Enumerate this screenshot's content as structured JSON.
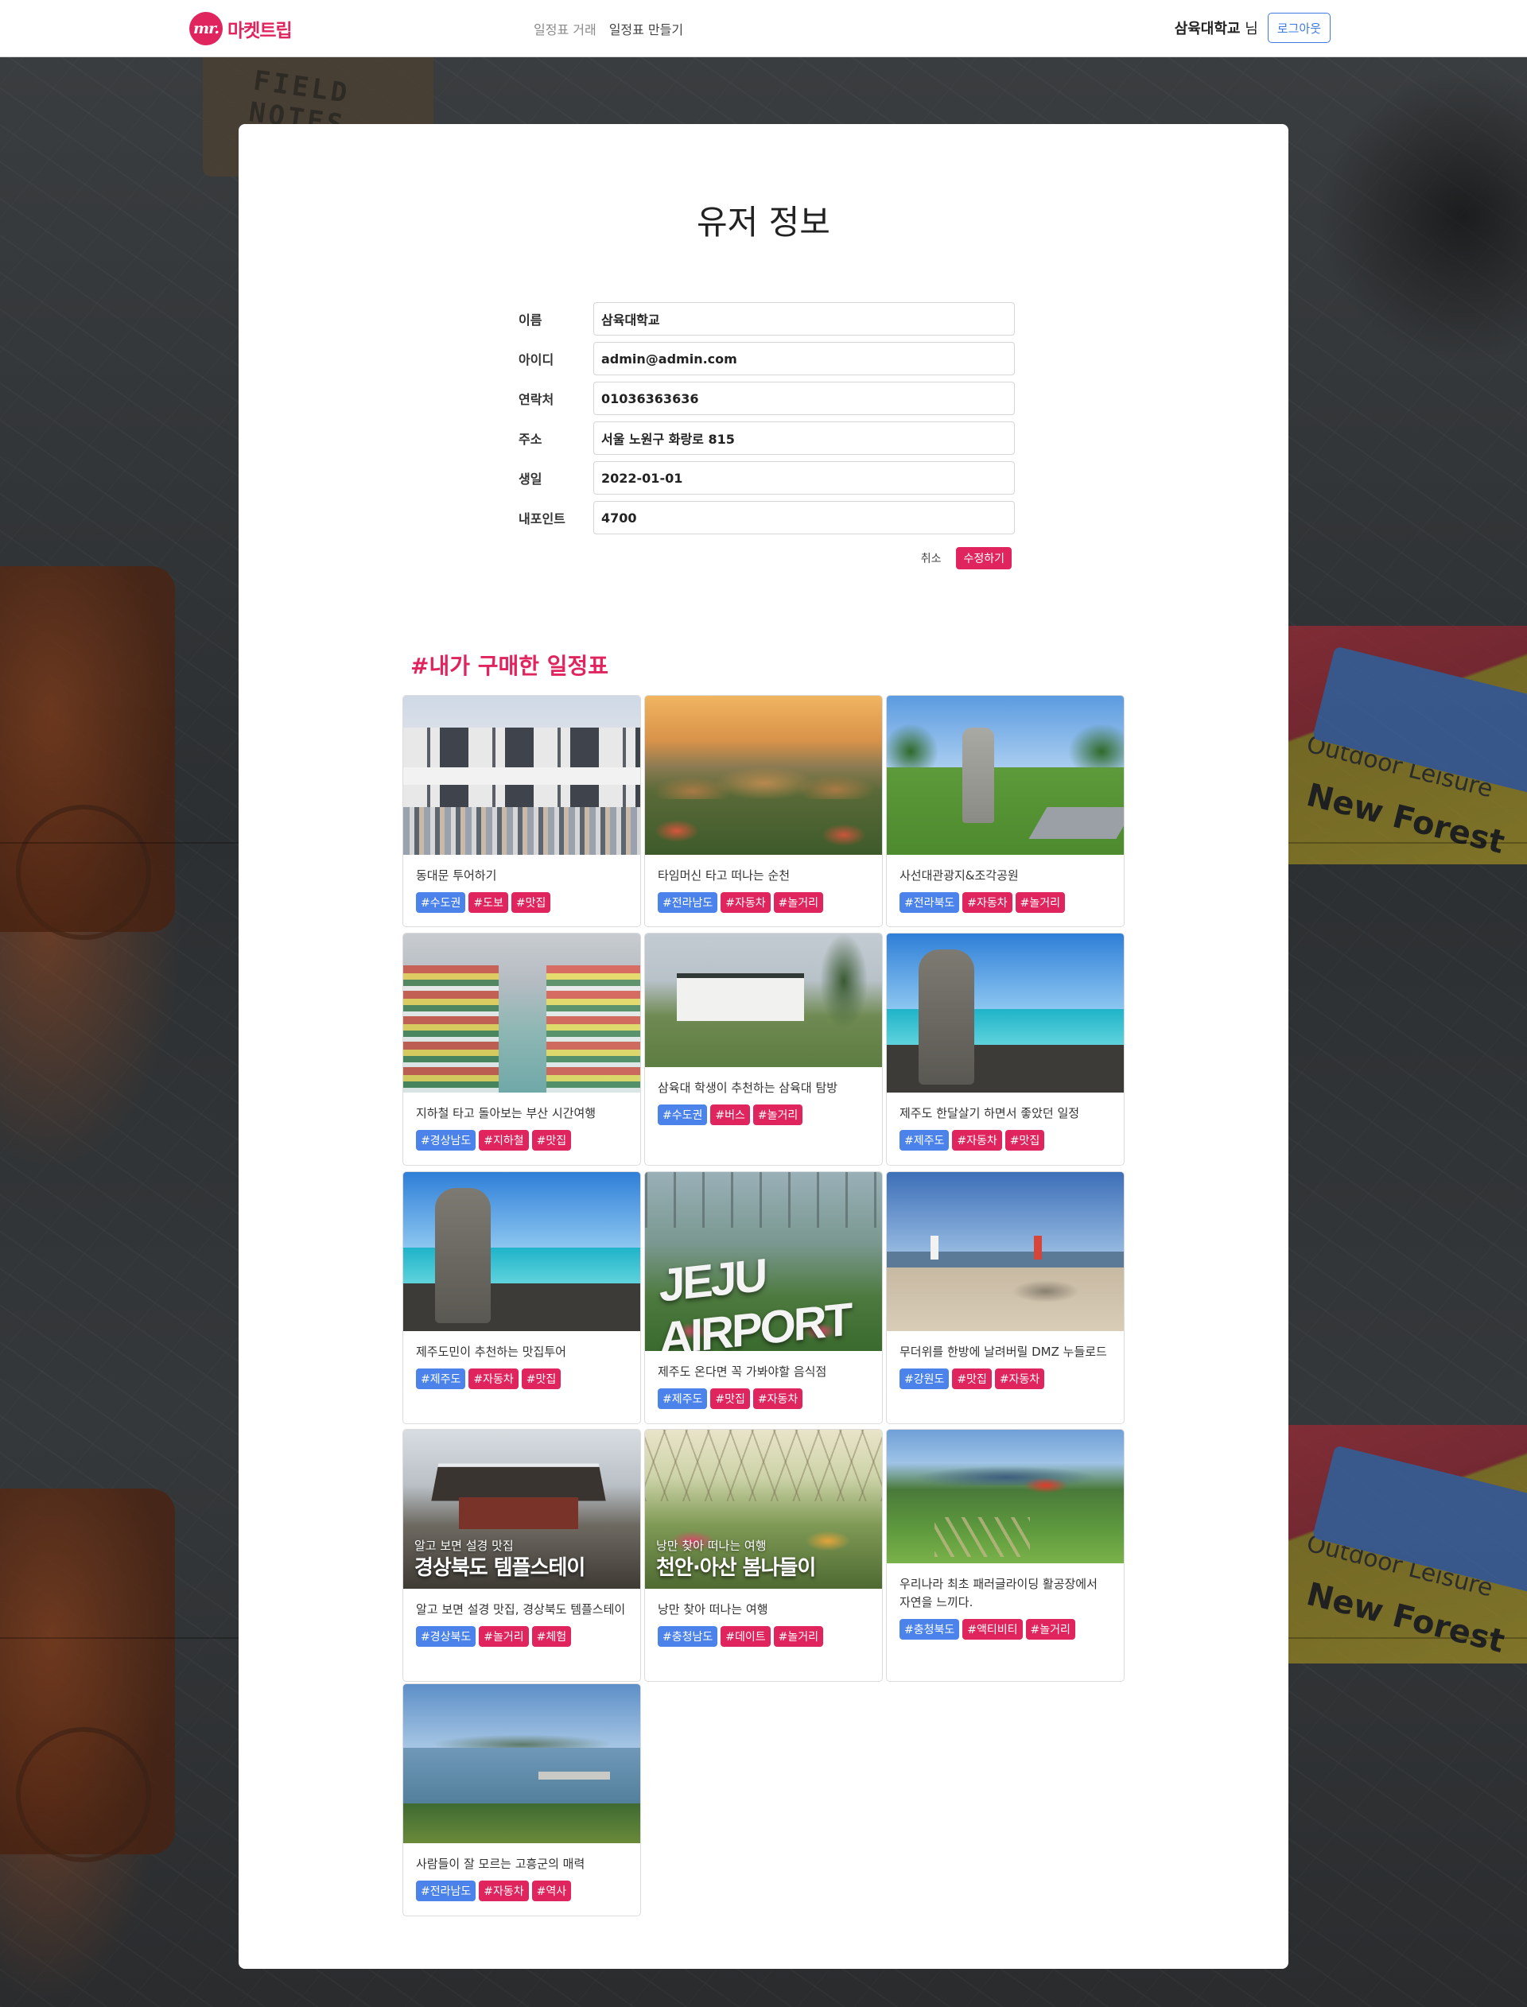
{
  "header": {
    "logo_mark": "mr.",
    "logo_text": "마켓트립",
    "nav": [
      "일정표 거래",
      "일정표 만들기"
    ],
    "user_name": "삼육대학교",
    "user_suffix": " 님",
    "logout_label": "로그아웃"
  },
  "page": {
    "title": "유저 정보",
    "form": [
      {
        "label": "이름",
        "value": "삼육대학교"
      },
      {
        "label": "아이디",
        "value": "admin@admin.com"
      },
      {
        "label": "연락처",
        "value": "01036363636"
      },
      {
        "label": "주소",
        "value": "서울 노원구 화랑로 815"
      },
      {
        "label": "생일",
        "value": "2022-01-01"
      },
      {
        "label": "내포인트",
        "value": "4700"
      }
    ],
    "cancel_label": "취소",
    "edit_label": "수정하기",
    "section_title": "#내가 구매한 일정표"
  },
  "colors": {
    "brand": "#e0245e",
    "region_tag": "#4b83ea",
    "keyword_tag": "#e0245e",
    "logout": "#3d7be3"
  },
  "cards": [
    {
      "title": "동대문 투어하기",
      "tags": [
        "#수도권",
        "#도보",
        "#맛집"
      ],
      "image": "dongdaemun-building"
    },
    {
      "title": "타임머신 타고 떠나는 순천",
      "tags": [
        "#전라남도",
        "#자동차",
        "#놀거리"
      ],
      "image": "suncheon-thatched-houses-sunset"
    },
    {
      "title": "사선대관광지&조각공원",
      "tags": [
        "#전라북도",
        "#자동차",
        "#놀거리"
      ],
      "image": "sculpture-park"
    },
    {
      "title": "지하철 타고 돌아보는 부산 시간여행",
      "tags": [
        "#경상남도",
        "#지하철",
        "#맛집"
      ],
      "image": "busan-market"
    },
    {
      "title": "삼육대 학생이 추천하는 삼육대 탐방",
      "tags": [
        "#수도권",
        "#버스",
        "#놀거리"
      ],
      "image": "campus-building"
    },
    {
      "title": "제주도 한달살기 하면서 좋았던 일정",
      "tags": [
        "#제주도",
        "#자동차",
        "#맛집"
      ],
      "image": "jeju-dolharubang-beach"
    },
    {
      "title": "제주도민이 추천하는 맛집투어",
      "tags": [
        "#제주도",
        "#자동차",
        "#맛집"
      ],
      "image": "jeju-dolharubang-beach"
    },
    {
      "title": "제주도 온다면 꼭 가봐야할 음식점",
      "tags": [
        "#제주도",
        "#맛집",
        "#자동차"
      ],
      "image": "jeju-airport-sign",
      "image_text": "JEJU AIRPORT"
    },
    {
      "title": "무더위를 한방에 날려버릴 DMZ 누들로드",
      "tags": [
        "#강원도",
        "#맛집",
        "#자동차"
      ],
      "image": "beach-lighthouse"
    },
    {
      "title": "알고 보면 설경 맛집, 경상북도 템플스테이",
      "tags": [
        "#경상북도",
        "#놀거리",
        "#체험"
      ],
      "image": "snowy-temple",
      "image_sub": "알고 보면 설경 맛집",
      "image_main": "경상북도 템플스테이"
    },
    {
      "title": "낭만 찾아 떠나는 여행",
      "tags": [
        "#충청남도",
        "#데이트",
        "#놀거리"
      ],
      "image": "greenhouse-garden",
      "image_sub": "낭만 찾아 떠나는 여행",
      "image_main": "천안·아산 봄나들이"
    },
    {
      "title": "우리나라 최초 패러글라이딩 활공장에서 자연을 느끼다.",
      "tags": [
        "#충청북도",
        "#액티비티",
        "#놀거리"
      ],
      "image": "paragliding-hill"
    },
    {
      "title": "사람들이 잘 모르는 고흥군의 매력",
      "tags": [
        "#전라남도",
        "#자동차",
        "#역사"
      ],
      "image": "coastal-bay"
    }
  ]
}
